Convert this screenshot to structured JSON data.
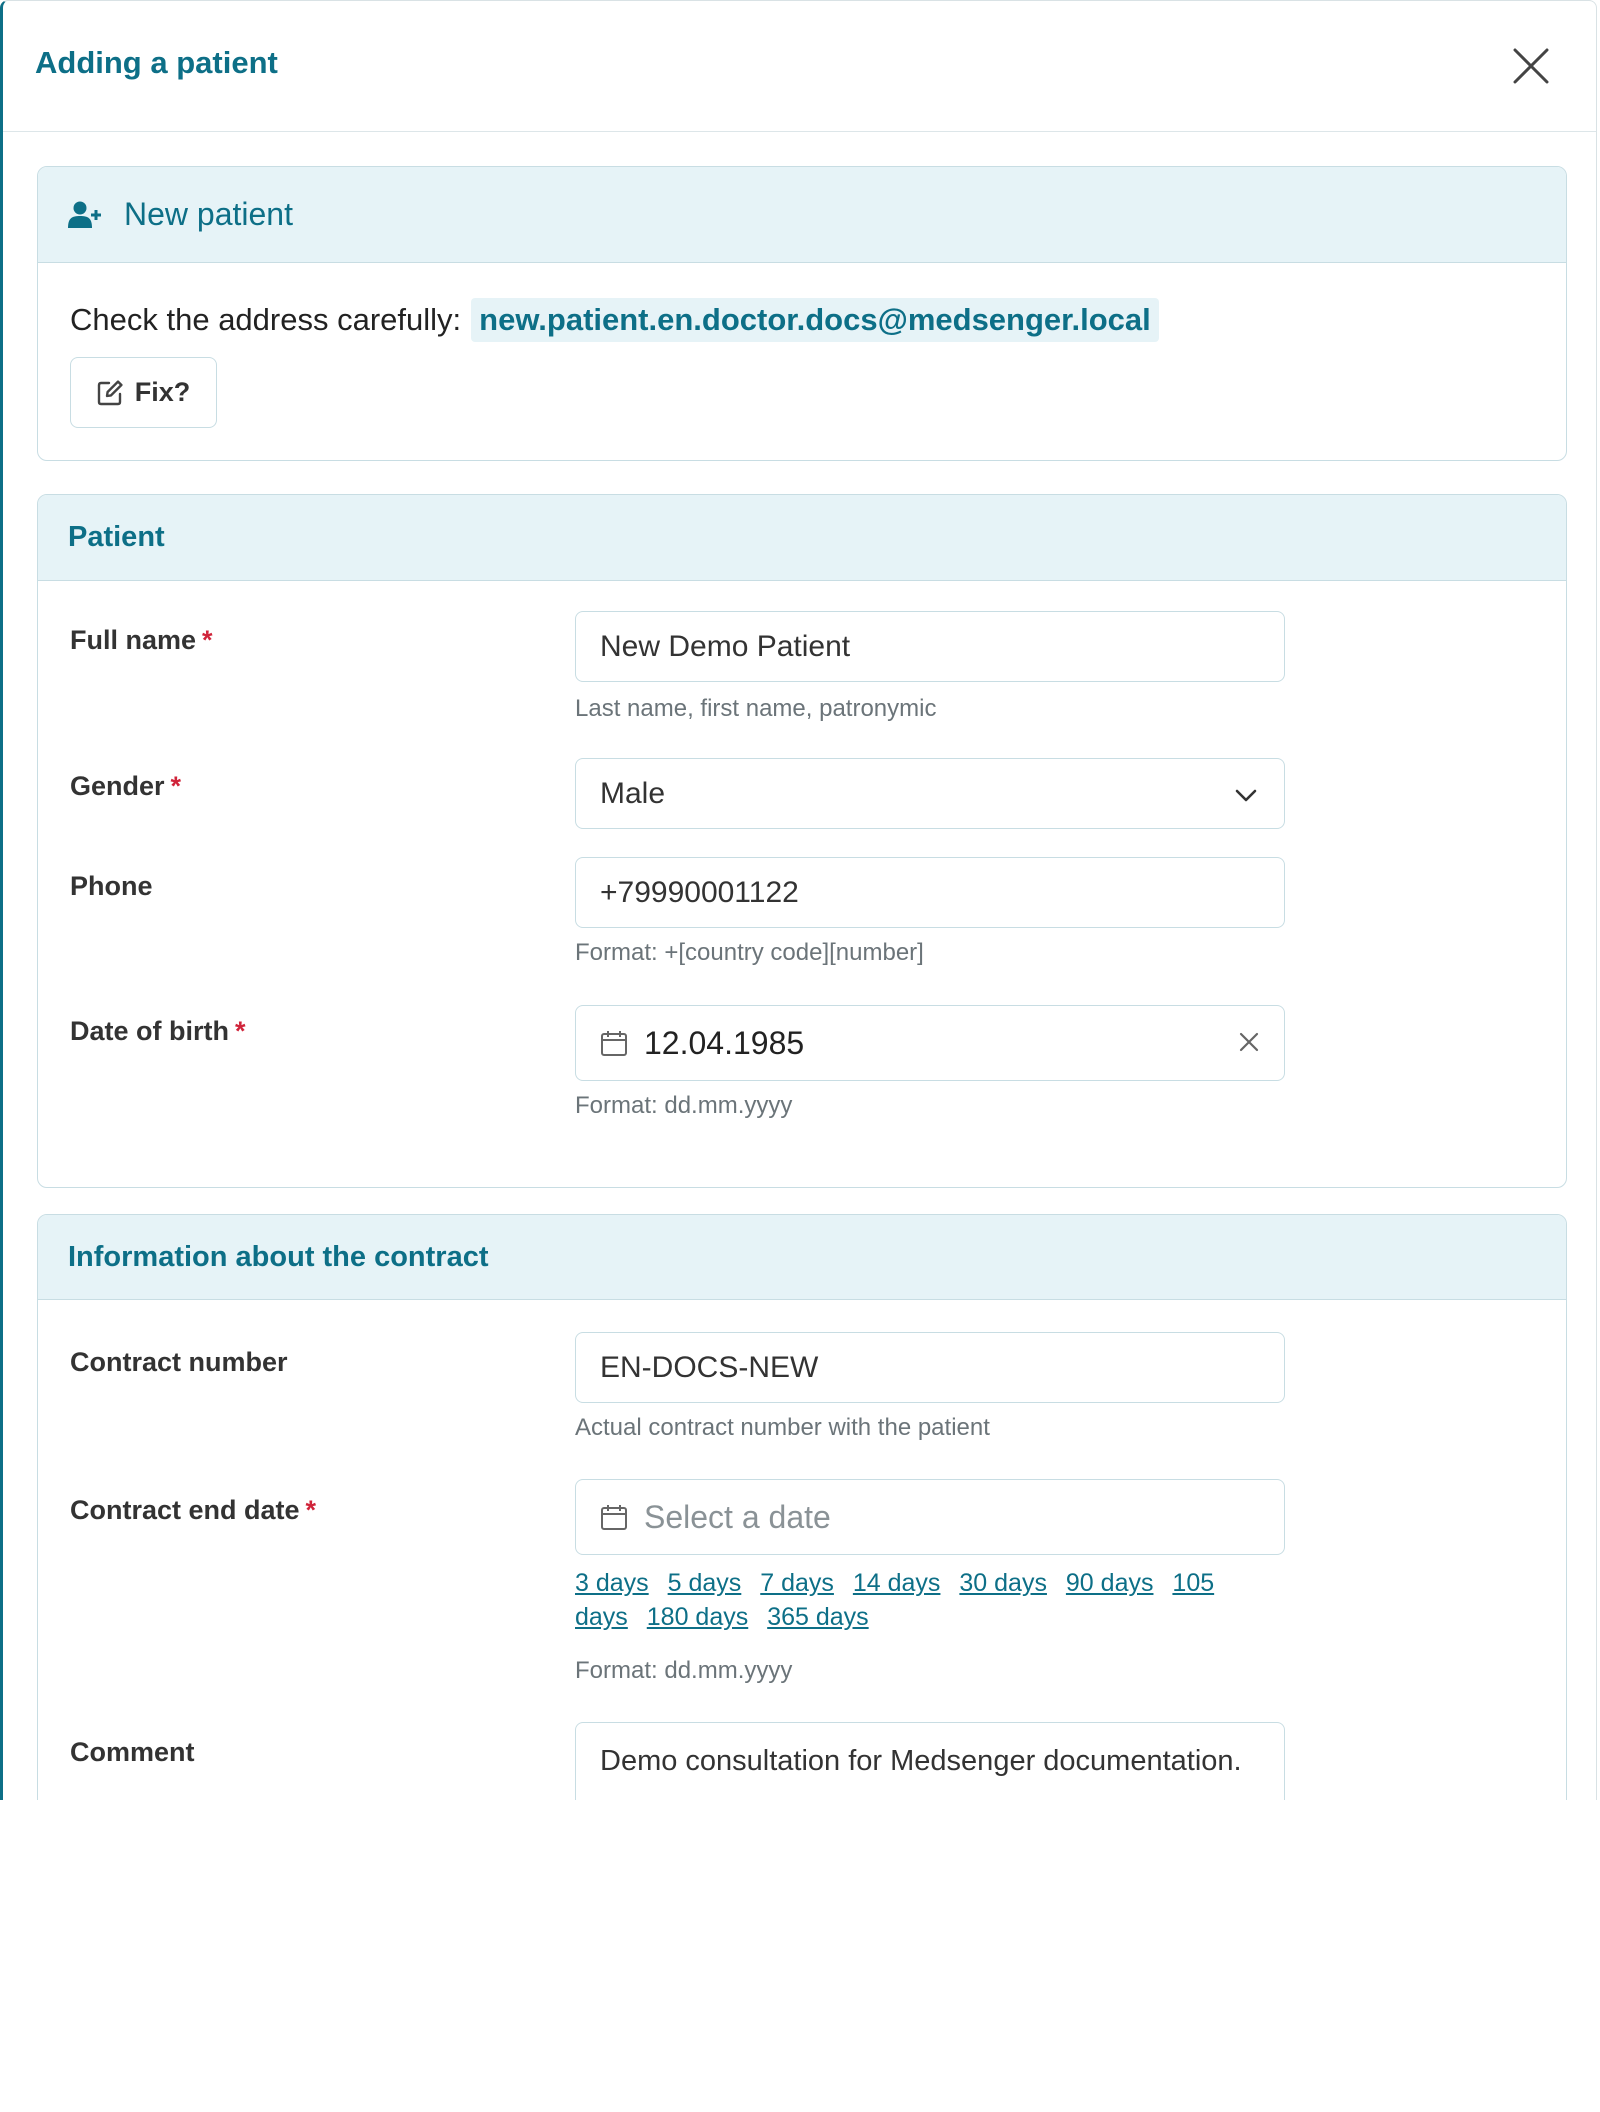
{
  "modal": {
    "title": "Adding a patient"
  },
  "new_patient": {
    "title": "New patient",
    "check_label": "Check the address carefully:",
    "email": "new.patient.en.doctor.docs@medsenger.local",
    "fix_label": "Fix?"
  },
  "patient": {
    "section_title": "Patient",
    "required_mark": "*",
    "full_name": {
      "label": "Full name",
      "value": "New Demo Patient",
      "hint": "Last name, first name, patronymic"
    },
    "gender": {
      "label": "Gender",
      "value": "Male"
    },
    "phone": {
      "label": "Phone",
      "value": "+79990001122",
      "hint": "Format: +[country code][number]"
    },
    "dob": {
      "label": "Date of birth",
      "value": "12.04.1985",
      "hint": "Format: dd.mm.yyyy"
    }
  },
  "contract": {
    "section_title": "Information about the contract",
    "required_mark": "*",
    "number": {
      "label": "Contract number",
      "value": "EN-DOCS-NEW",
      "hint": "Actual contract number with the patient"
    },
    "end_date": {
      "label": "Contract end date",
      "placeholder": "Select a date",
      "quick": [
        "3 days",
        "5 days",
        "7 days",
        "14 days",
        "30 days",
        "90 days",
        "105 days",
        "180 days",
        "365 days"
      ],
      "hint": "Format: dd.mm.yyyy"
    },
    "comment": {
      "label": "Comment",
      "value": "Demo consultation for Medsenger documentation."
    }
  },
  "colors": {
    "accent": "#0d6f87",
    "header_bg": "#e6f3f7",
    "border": "#c8dde3",
    "required": "#d0243a"
  },
  "icons": {
    "close": "close-icon",
    "add_user": "user-plus-icon",
    "edit": "edit-icon",
    "chevron": "chevron-down-icon",
    "calendar": "calendar-icon",
    "clear": "clear-icon"
  }
}
